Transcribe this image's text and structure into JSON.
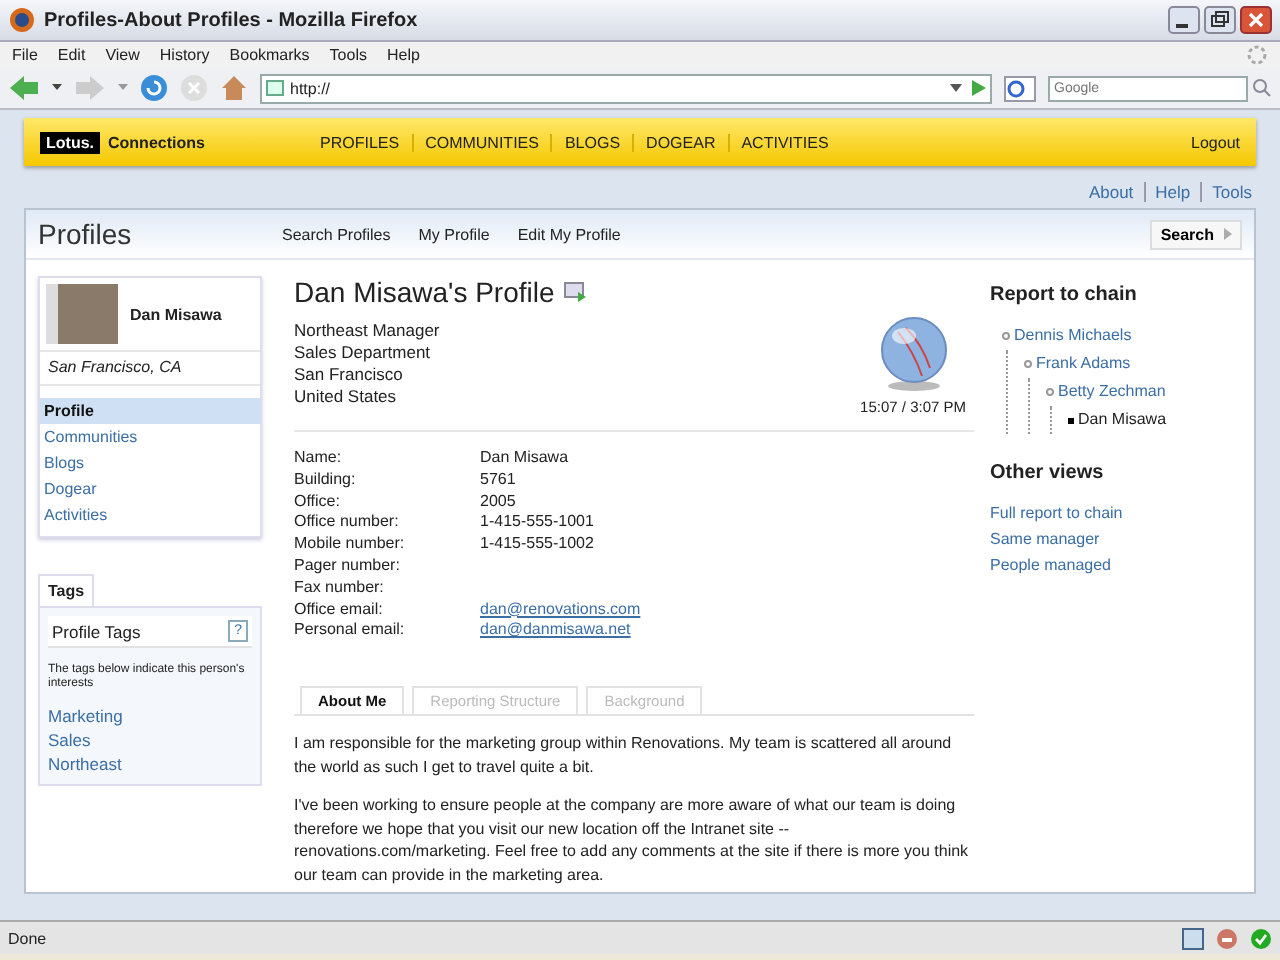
{
  "window": {
    "title": "Profiles-About Profiles - Mozilla Firefox"
  },
  "menu": [
    "File",
    "Edit",
    "View",
    "History",
    "Bookmarks",
    "Tools",
    "Help"
  ],
  "address_bar": {
    "value": "http://"
  },
  "search_bar": {
    "placeholder": "Google"
  },
  "banner": {
    "logo": "Lotus.",
    "product": "Connections",
    "links": [
      "PROFILES",
      "COMMUNITIES",
      "BLOGS",
      "DOGEAR",
      "ACTIVITIES"
    ],
    "logout": "Logout"
  },
  "top_links": [
    "About",
    "Help",
    "Tools"
  ],
  "header": {
    "title": "Profiles",
    "tabs": [
      "Search Profiles",
      "My Profile",
      "Edit My Profile"
    ],
    "search_button": "Search"
  },
  "person_card": {
    "name": "Dan Misawa",
    "location": "San Francisco, CA"
  },
  "sidebar": {
    "items": [
      {
        "label": "Profile",
        "selected": true
      },
      {
        "label": "Communities",
        "selected": false
      },
      {
        "label": "Blogs",
        "selected": false
      },
      {
        "label": "Dogear",
        "selected": false
      },
      {
        "label": "Activities",
        "selected": false
      }
    ]
  },
  "tags": {
    "tab": "Tags",
    "title": "Profile Tags",
    "help": "?",
    "description": "The tags below indicate this person's interests",
    "items": [
      "Marketing",
      "Sales",
      "Northeast"
    ]
  },
  "profile": {
    "heading": "Dan Misawa's Profile",
    "address": [
      "Northeast Manager",
      "Sales Department",
      "San Francisco",
      "United States"
    ],
    "local_time": "15:07 / 3:07 PM",
    "fields": [
      {
        "label": "Name:",
        "value": "Dan Misawa",
        "kind": "text"
      },
      {
        "label": "Building:",
        "value": "5761",
        "kind": "text"
      },
      {
        "label": "Office:",
        "value": "2005",
        "kind": "text"
      },
      {
        "label": "Office number:",
        "value": "1-415-555-1001",
        "kind": "text"
      },
      {
        "label": "Mobile number:",
        "value": "1-415-555-1002",
        "kind": "text"
      },
      {
        "label": "Pager number:",
        "kind": "text"
      },
      {
        "label": "Fax number:",
        "kind": "text"
      },
      {
        "label": "Office email:",
        "value": "dan@renovations.com",
        "kind": "link"
      },
      {
        "label": "Personal email:",
        "value": "dan@danmisawa.net",
        "kind": "link"
      }
    ],
    "tabs": [
      {
        "label": "About Me",
        "selected": true
      },
      {
        "label": "Reporting Structure",
        "selected": false
      },
      {
        "label": "Background",
        "selected": false
      }
    ],
    "about": [
      "I am responsible for the marketing group within Renovations. My team is scattered all around the world as such I get to travel quite a bit.",
      "I've been working to ensure people at the company are more aware of what our team is doing therefore we hope that you visit our new location off the Intranet site -- renovations.com/marketing. Feel free to add any comments at the site if there is more you think our team can provide in the marketing area."
    ]
  },
  "report_chain": {
    "title": "Report to chain",
    "tree": [
      {
        "name": "Dennis Michaels",
        "current": false,
        "children": [
          {
            "name": "Frank Adams",
            "current": false,
            "children": [
              {
                "name": "Betty Zechman",
                "current": false,
                "children": [
                  {
                    "name": "Dan Misawa",
                    "current": true
                  }
                ]
              }
            ]
          }
        ]
      }
    ]
  },
  "other_views": {
    "title": "Other views",
    "links": [
      "Full report to chain",
      "Same manager",
      "People managed"
    ]
  },
  "status_bar": {
    "text": "Done"
  }
}
